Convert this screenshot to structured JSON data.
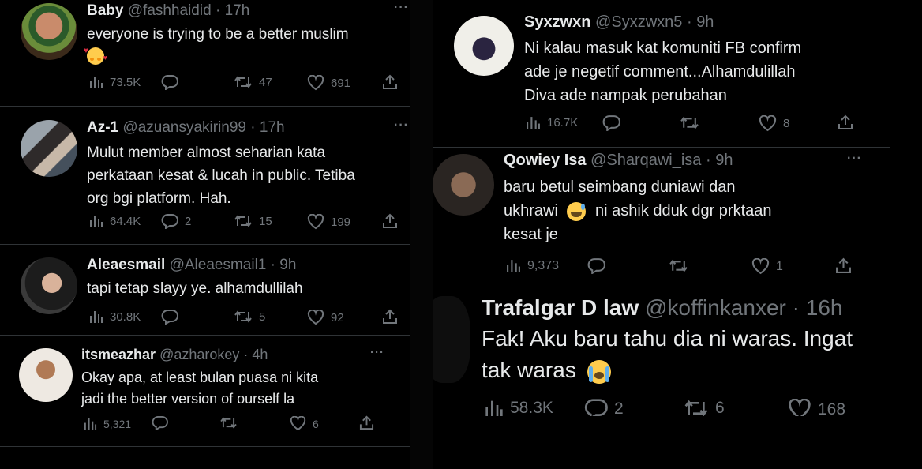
{
  "colors": {
    "background": "#000000",
    "text": "#e7e9ea",
    "muted": "#71767b",
    "divider": "#2f3336"
  },
  "left_tweets": [
    {
      "name": "Baby",
      "handle": "@fashhaidid",
      "sep": "·",
      "time": "17h",
      "lines": [
        "everyone is trying to be a better muslim"
      ],
      "emoji": "smiling-face-with-hearts",
      "views": "73.5K",
      "replies": "",
      "retweets": "47",
      "likes": "691"
    },
    {
      "name": "Az-1",
      "handle": "@azuansyakirin99",
      "sep": "·",
      "time": "17h",
      "lines": [
        "Mulut member almost seharian kata",
        "perkataan kesat & lucah in public. Tetiba",
        "org bgi platform. Hah."
      ],
      "views": "64.4K",
      "replies": "2",
      "retweets": "15",
      "likes": "199"
    },
    {
      "name": "Aleaesmail",
      "handle": "@Aleaesmail1",
      "sep": "·",
      "time": "9h",
      "lines": [
        "tapi tetap slayy ye. alhamdullilah"
      ],
      "views": "30.8K",
      "replies": "",
      "retweets": "5",
      "likes": "92"
    },
    {
      "name": "itsmeazhar",
      "handle": "@azharokey",
      "sep": "·",
      "time": "4h",
      "lines": [
        "Okay apa, at least bulan puasa ni kita",
        "jadi the better version of ourself la"
      ],
      "views": "5,321",
      "replies": "",
      "retweets": "",
      "likes": "6"
    }
  ],
  "right_tweets": [
    {
      "name": "Syxzwxn",
      "handle": "@Syxzwxn5",
      "sep": "·",
      "time": "9h",
      "lines": [
        "Ni kalau masuk kat komuniti FB confirm",
        "ade je negetif comment...Alhamdulillah",
        "Diva ade nampak perubahan"
      ],
      "views": "16.7K",
      "replies": "",
      "retweets": "",
      "likes": "8"
    },
    {
      "name": "Qowiey Isa",
      "handle": "@Sharqawi_isa",
      "sep": "·",
      "time": "9h",
      "line1_a": "baru betul seimbang duniawi dan",
      "line2_a": "ukhrawi",
      "line2_b": "ni ashik dduk dgr prktaan",
      "line3": "kesat je",
      "emoji": "grinning-face-with-sweat",
      "views": "9,373",
      "replies": "",
      "retweets": "",
      "likes": "1"
    },
    {
      "name": "Trafalgar D law",
      "handle": "@koffinkanxer",
      "sep": "·",
      "time": "16h",
      "line1": "Fak! Aku baru tahu dia ni waras. Ingat",
      "line2": "tak waras",
      "emoji": "loudly-crying-face",
      "views": "58.3K",
      "replies": "2",
      "retweets": "6",
      "likes": "168"
    }
  ]
}
